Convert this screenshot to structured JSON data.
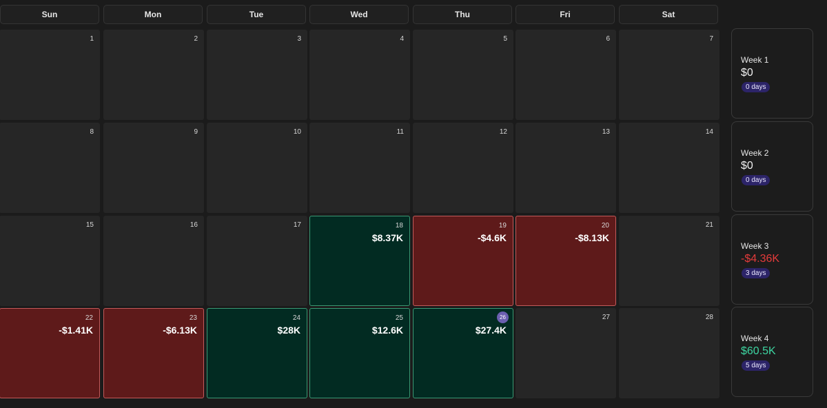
{
  "weekdays": [
    "Sun",
    "Mon",
    "Tue",
    "Wed",
    "Thu",
    "Fri",
    "Sat"
  ],
  "days": [
    {
      "day": "1",
      "pnl": ""
    },
    {
      "day": "2",
      "pnl": ""
    },
    {
      "day": "3",
      "pnl": ""
    },
    {
      "day": "4",
      "pnl": ""
    },
    {
      "day": "5",
      "pnl": ""
    },
    {
      "day": "6",
      "pnl": ""
    },
    {
      "day": "7",
      "pnl": ""
    },
    {
      "day": "8",
      "pnl": ""
    },
    {
      "day": "9",
      "pnl": ""
    },
    {
      "day": "10",
      "pnl": ""
    },
    {
      "day": "11",
      "pnl": ""
    },
    {
      "day": "12",
      "pnl": ""
    },
    {
      "day": "13",
      "pnl": ""
    },
    {
      "day": "14",
      "pnl": ""
    },
    {
      "day": "15",
      "pnl": ""
    },
    {
      "day": "16",
      "pnl": ""
    },
    {
      "day": "17",
      "pnl": ""
    },
    {
      "day": "18",
      "pnl": "$8.37K",
      "status": "profit"
    },
    {
      "day": "19",
      "pnl": "-$4.6K",
      "status": "loss"
    },
    {
      "day": "20",
      "pnl": "-$8.13K",
      "status": "loss"
    },
    {
      "day": "21",
      "pnl": ""
    },
    {
      "day": "22",
      "pnl": "-$1.41K",
      "status": "loss"
    },
    {
      "day": "23",
      "pnl": "-$6.13K",
      "status": "loss"
    },
    {
      "day": "24",
      "pnl": "$28K",
      "status": "profit"
    },
    {
      "day": "25",
      "pnl": "$12.6K",
      "status": "profit"
    },
    {
      "day": "26",
      "pnl": "$27.4K",
      "status": "profit",
      "today": true
    },
    {
      "day": "27",
      "pnl": ""
    },
    {
      "day": "28",
      "pnl": ""
    }
  ],
  "weeks": [
    {
      "label": "Week 1",
      "total": "$0",
      "days": "0 days",
      "sign": "zero"
    },
    {
      "label": "Week 2",
      "total": "$0",
      "days": "0 days",
      "sign": "zero"
    },
    {
      "label": "Week 3",
      "total": "-$4.36K",
      "days": "3 days",
      "sign": "neg"
    },
    {
      "label": "Week 4",
      "total": "$60.5K",
      "days": "5 days",
      "sign": "pos"
    }
  ],
  "colors": {
    "profit_bg": "#022b22",
    "loss_bg": "#5e1a1a",
    "positive_text": "#3dd6a1",
    "negative_text": "#e53b3b",
    "today_badge": "#6b5fb0",
    "days_badge": "#2c2468"
  }
}
